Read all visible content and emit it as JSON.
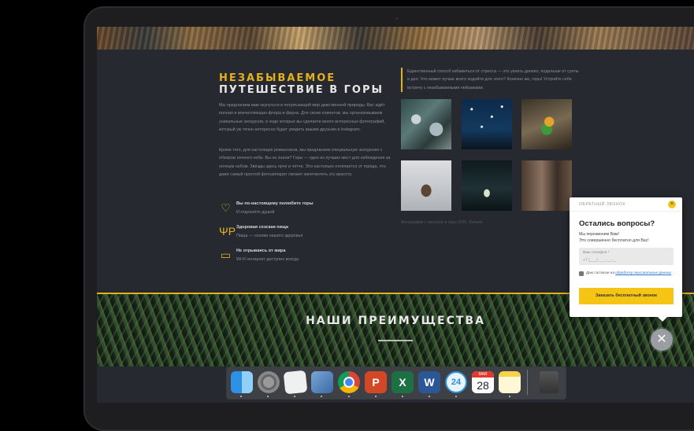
{
  "hero": {
    "title_line1": "НЕЗАБЫВАЕМОЕ",
    "title_line2": "ПУТЕШЕСТВИЕ В ГОРЫ"
  },
  "intro": {
    "paragraph1": "Мы предлагаем вам окунуться в потрясающий мир девственной природы. Вас ждёт полная и впечатляющая флора и фауна. Для своих клиентов, мы организовываем уникальные экскурсии, в ходе которых вы сделаете много интересных фотографий, который уж точно интересно будет увидеть вашим друзьям в Instagram.",
    "paragraph2": "Кроме того, для настоящих романтиков, мы предлагаем специальную экскурсию с обзором ночного неба. Вы не знали? Горы — одно из лучших мест для наблюдения за ночным небом. Звёзды здесь ярче и чётче. Это настолько отличается от города, что даже самый простой фотоаппарат сможет запечатлеть эту красоту."
  },
  "features": [
    {
      "icon": "heart-icon",
      "title": "Вы по-настоящему полюбите горы",
      "subtitle": "И отдохнёте душой"
    },
    {
      "icon": "fork-knife-icon",
      "title": "Здоровая сезская пища",
      "subtitle": "Пища — основа нашего здоровья"
    },
    {
      "icon": "laptop-icon",
      "title": "Не отрываясь от мира",
      "subtitle": "Wi-Fi интернет доступен всегда"
    }
  ],
  "quote": "Единственный способ избавиться от стресса — это уехать далеко, подальше от суеты и дел. Что может лучше всего подойти для этого? Конечно же, горы! Устройте себе встречу с незабываемыми пейзажами.",
  "gallery": {
    "caption": "Фотографии с прогулок в горы 2020. Лучшие"
  },
  "advantages": {
    "title": "НАШИ ПРЕИМУЩЕСТВА"
  },
  "popup": {
    "header": "ОБРАТНЫЙ ЗВОНОК",
    "close_glyph": "✕",
    "title": "Остались вопросы?",
    "subtitle_line1": "Мы перезвоним Вам!",
    "subtitle_line2": "Это совершенно бесплатно для Вас!",
    "phone_label": "Ваш телефон *",
    "phone_placeholder": "+7 (___) ___-__-__",
    "agree_text": "Даю согласие на ",
    "agree_link": "обработку персональных данных",
    "submit_label": "Заказать бесплатный звонок"
  },
  "fab": {
    "glyph": "✕"
  },
  "dock": {
    "items": [
      "finder",
      "system-preferences",
      "textedit",
      "preview",
      "chrome",
      "powerpoint",
      "excel",
      "word",
      "clock",
      "calendar",
      "notes",
      "trash"
    ],
    "ppt_letter": "P",
    "excel_letter": "X",
    "word_letter": "W",
    "clock_text": "24",
    "calendar_month": "MAR",
    "calendar_day": "28"
  },
  "colors": {
    "accent": "#e3b11c",
    "background": "#262a30"
  }
}
